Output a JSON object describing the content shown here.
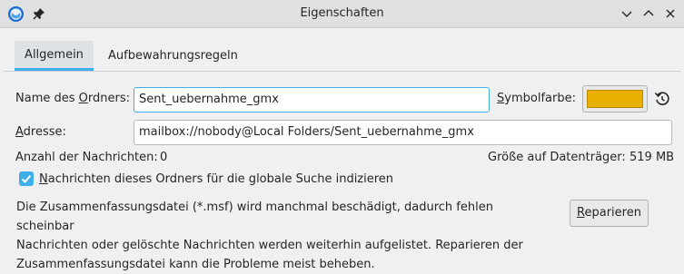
{
  "window": {
    "title": "Eigenschaften"
  },
  "tabs": [
    {
      "label": "Allgemein",
      "active": true
    },
    {
      "label": "Aufbewahrungsregeln",
      "active": false
    }
  ],
  "folder_name": {
    "label_prefix": "Name des ",
    "label_accel": "O",
    "label_suffix": "rdners:",
    "value": "Sent_uebernahme_gmx"
  },
  "symbol_color": {
    "label_accel": "S",
    "label_rest": "ymbolfarbe:",
    "value": "#e8b000"
  },
  "address": {
    "label_accel": "A",
    "label_rest": "dresse:",
    "value": "mailbox://nobody@Local Folders/Sent_uebernahme_gmx"
  },
  "stats": {
    "messages_label": "Anzahl der Nachrichten:",
    "messages_value": "0",
    "size_label": "Größe auf Datenträger:",
    "size_value": "519 MB"
  },
  "index_checkbox": {
    "checked": true,
    "label_accel": "N",
    "label_rest": "achrichten dieses Ordners für die globale Suche indizieren"
  },
  "summary": {
    "lines": [
      "Die Zusammenfassungsdatei (*.msf) wird manchmal beschädigt, dadurch fehlen scheinbar",
      "Nachrichten oder gelöschte Nachrichten werden weiterhin aufgelistet. Reparieren der",
      "Zusammenfassungsdatei kann die Probleme meist beheben."
    ],
    "repair_accel": "R",
    "repair_rest": "eparieren"
  }
}
